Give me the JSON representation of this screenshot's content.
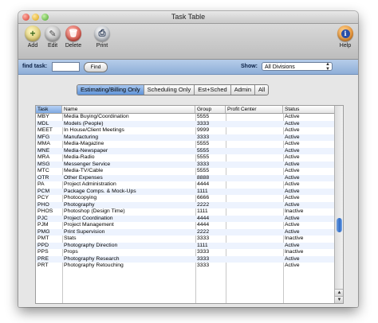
{
  "window": {
    "title": "Task Table"
  },
  "toolbar": {
    "add_label": "Add",
    "edit_label": "Edit",
    "delete_label": "Delete",
    "print_label": "Print",
    "help_label": "Help",
    "add_icon": "+",
    "edit_icon": "✎",
    "delete_icon": "🗑",
    "print_icon": "⎙",
    "help_icon": "i"
  },
  "findbar": {
    "find_label": "find task:",
    "find_value": "",
    "find_button": "Find",
    "show_label": "Show:",
    "show_value": "All Divisions"
  },
  "tabs": [
    {
      "label": "Estimating/Billing Only",
      "active": true
    },
    {
      "label": "Scheduling Only",
      "active": false
    },
    {
      "label": "Est+Sched",
      "active": false
    },
    {
      "label": "Admin",
      "active": false
    },
    {
      "label": "All",
      "active": false
    }
  ],
  "table": {
    "columns": [
      "Task",
      "Name",
      "Group",
      "Profit Center",
      "Status"
    ],
    "rows": [
      [
        "MBY",
        "Media Buying/Coordination",
        "5555",
        "",
        "Active"
      ],
      [
        "MDL",
        "Models (People)",
        "3333",
        "",
        "Active"
      ],
      [
        "MEET",
        "In House/Client Meetings",
        "9999",
        "",
        "Active"
      ],
      [
        "MFG",
        "Manufacturing",
        "3333",
        "",
        "Active"
      ],
      [
        "MMA",
        "Media-Magazine",
        "5555",
        "",
        "Active"
      ],
      [
        "MNE",
        "Media-Newspaper",
        "5555",
        "",
        "Active"
      ],
      [
        "MRA",
        "Media-Radio",
        "5555",
        "",
        "Active"
      ],
      [
        "MSG",
        "Messenger Service",
        "3333",
        "",
        "Active"
      ],
      [
        "MTC",
        "Media-TV/Cable",
        "5555",
        "",
        "Active"
      ],
      [
        "OTR",
        "Other Expenses",
        "8888",
        "",
        "Active"
      ],
      [
        "PA",
        "Project Administration",
        "4444",
        "",
        "Active"
      ],
      [
        "PCM",
        "Package Comps. & Mock-Ups",
        "1111",
        "",
        "Active"
      ],
      [
        "PCY",
        "Photocopying",
        "6666",
        "",
        "Active"
      ],
      [
        "PHO",
        "Photography",
        "2222",
        "",
        "Active"
      ],
      [
        "PHOS",
        "Photoshop (Design Time)",
        "1111",
        "",
        "Inactive"
      ],
      [
        "PJC",
        "Project Coordination",
        "4444",
        "",
        "Active"
      ],
      [
        "PJM",
        "Project Management",
        "4444",
        "",
        "Active"
      ],
      [
        "PMG",
        "Print Supervision",
        "2222",
        "",
        "Active"
      ],
      [
        "PMT",
        "Stats",
        "3333",
        "",
        "Inactive"
      ],
      [
        "PPD",
        "Photography Direction",
        "1111",
        "",
        "Active"
      ],
      [
        "PPS",
        "Props",
        "3333",
        "",
        "Inactive"
      ],
      [
        "PRE",
        "Photography Research",
        "3333",
        "",
        "Active"
      ],
      [
        "PRT",
        "Photography Retouching",
        "3333",
        "",
        "Active"
      ]
    ]
  }
}
